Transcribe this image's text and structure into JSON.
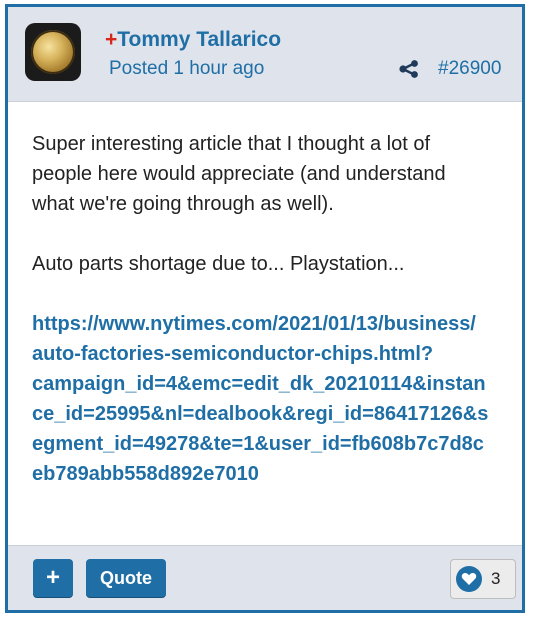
{
  "post": {
    "author_prefix": "+",
    "author": "Tommy Tallarico",
    "posted": "Posted 1 hour ago",
    "number": "#26900",
    "body": {
      "paragraph1_lines": [
        "Super interesting article that I thought a lot of",
        "people here would appreciate (and understand",
        "what we're going through as well)."
      ],
      "paragraph2": "Auto parts shortage due to... Playstation...",
      "link_lines": [
        "https://www.nytimes.com/2021/01/13/business/",
        "auto-factories-semiconductor-chips.html?",
        "campaign_id=4&emc=edit_dk_20210114&instan",
        "ce_id=25995&nl=dealbook&regi_id=86417126&s",
        "egment_id=49278&te=1&user_id=fb608b7c7d8c",
        "eb789abb558d892e7010"
      ]
    }
  },
  "footer": {
    "plus_label": "+",
    "quote_label": "Quote",
    "like_count": "3"
  },
  "colors": {
    "accent": "#1f6fa6",
    "author_prefix": "#d7261b",
    "header_bg": "#dfe4ec"
  },
  "icons": {
    "share": "share-icon",
    "like": "heart-icon"
  }
}
